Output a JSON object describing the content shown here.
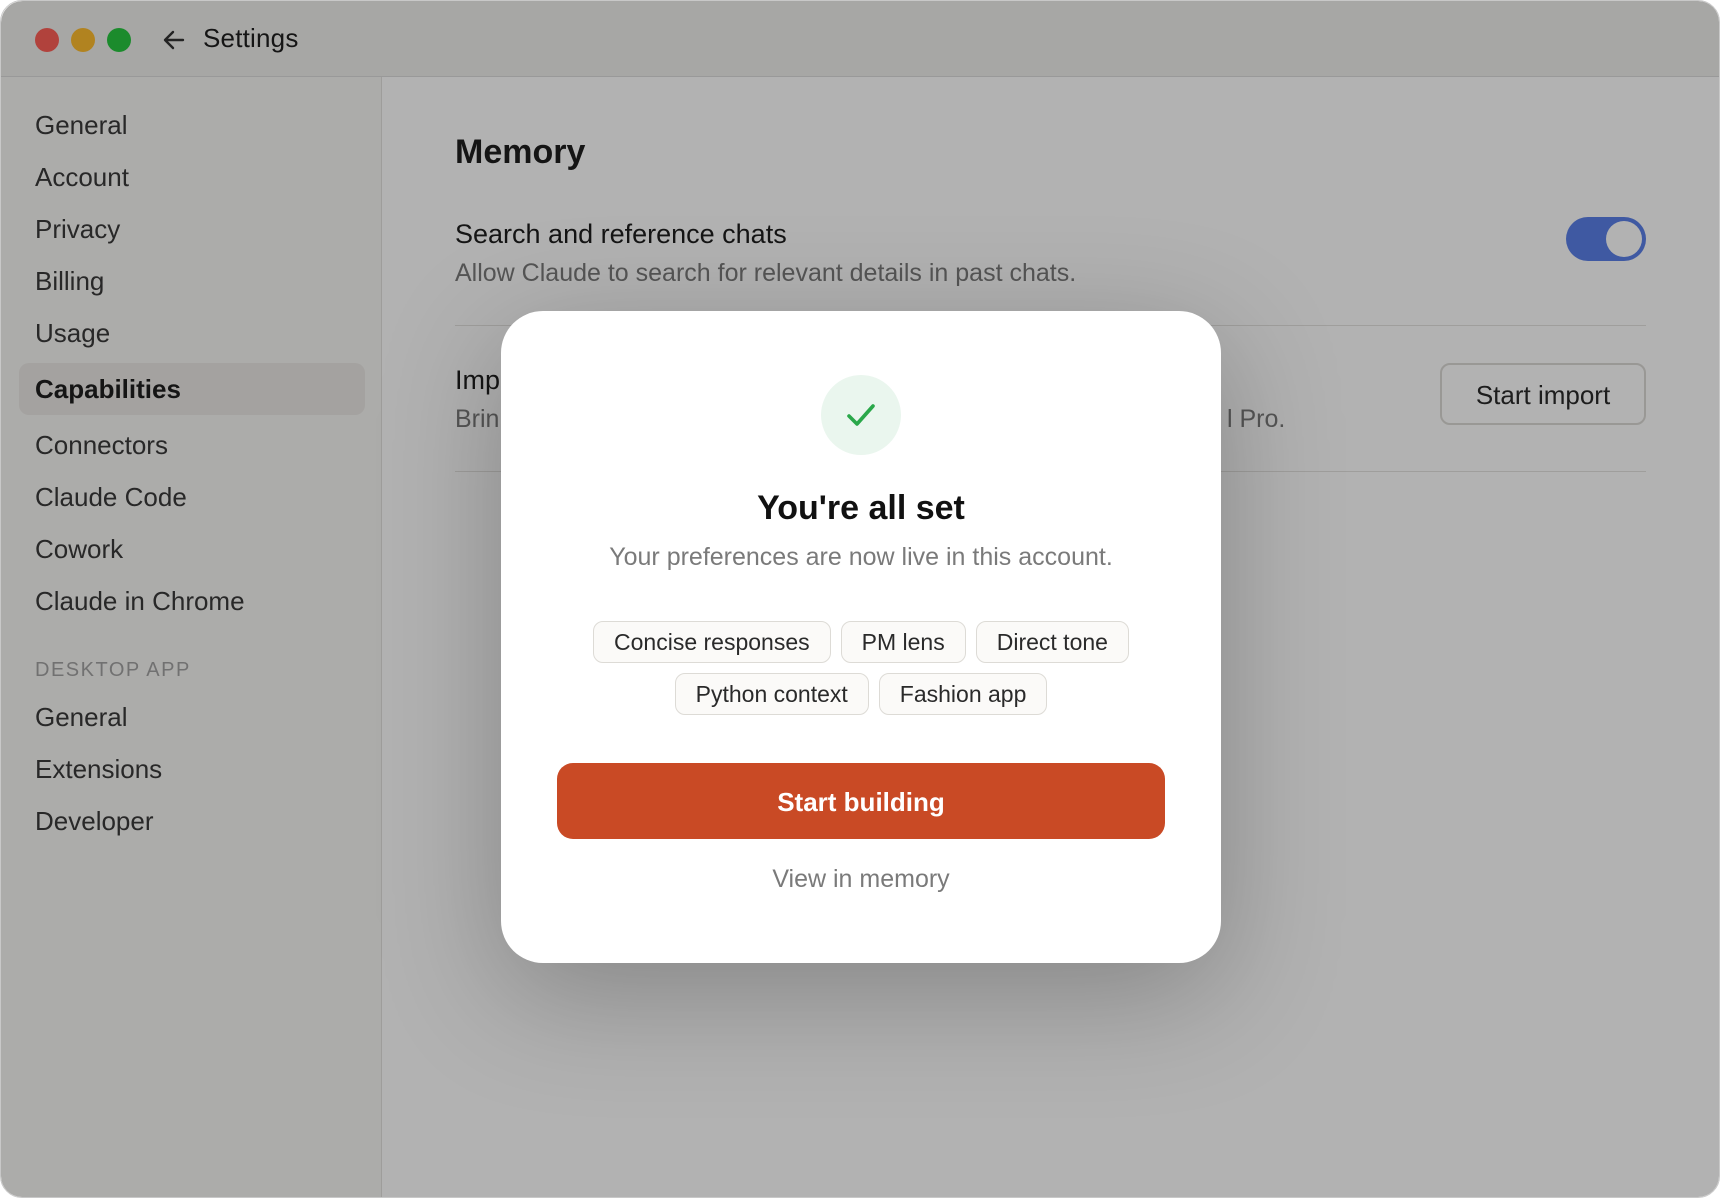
{
  "window": {
    "title": "Settings"
  },
  "sidebar": {
    "items": [
      {
        "label": "General",
        "active": false
      },
      {
        "label": "Account",
        "active": false
      },
      {
        "label": "Privacy",
        "active": false
      },
      {
        "label": "Billing",
        "active": false
      },
      {
        "label": "Usage",
        "active": false
      },
      {
        "label": "Capabilities",
        "active": true
      },
      {
        "label": "Connectors",
        "active": false
      },
      {
        "label": "Claude Code",
        "active": false
      },
      {
        "label": "Cowork",
        "active": false
      },
      {
        "label": "Claude in Chrome",
        "active": false
      }
    ],
    "section_label": "DESKTOP APP",
    "desktop_items": [
      {
        "label": "General"
      },
      {
        "label": "Extensions"
      },
      {
        "label": "Developer"
      }
    ]
  },
  "main": {
    "title": "Memory",
    "search_row": {
      "title": "Search and reference chats",
      "description": "Allow Claude to search for relevant details in past chats.",
      "toggle_on": true
    },
    "import_row": {
      "title_visible": "Imp",
      "description_visible_start": "Brin",
      "description_visible_end": "l Pro.",
      "button_label": "Start import"
    }
  },
  "modal": {
    "icon": "check-icon",
    "title": "You're all set",
    "subtitle": "Your preferences are now live in this account.",
    "chips": [
      "Concise responses",
      "PM lens",
      "Direct tone",
      "Python context",
      "Fashion app"
    ],
    "primary_button": "Start building",
    "secondary_link": "View in memory"
  },
  "colors": {
    "accent": "#c94a25",
    "toggle": "#5b80e8",
    "success": "#2aa84a"
  }
}
